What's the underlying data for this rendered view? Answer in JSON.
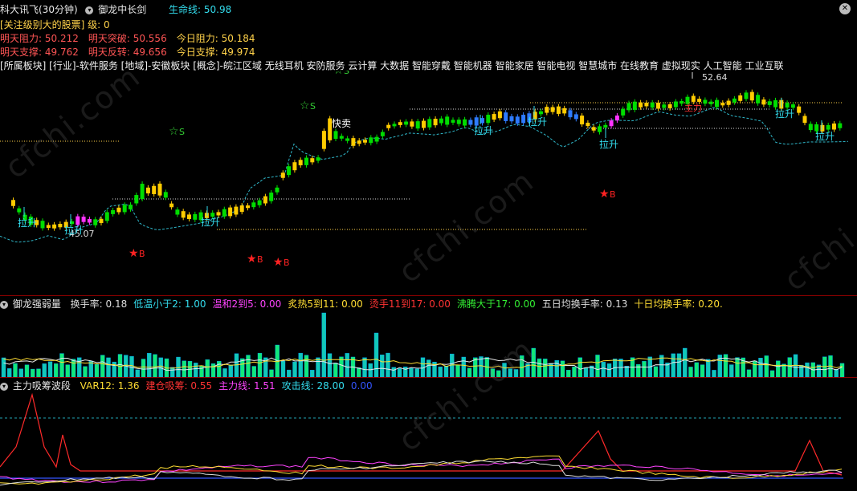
{
  "header": {
    "title": "科大讯飞(30分钟)",
    "indicator": "御龙中长剑",
    "lifeline_label": "生命线:",
    "lifeline_value": "50.98",
    "close_glyph": "✕"
  },
  "info": {
    "level_line": "[关注级别大的股票] 级: 0",
    "row1": [
      {
        "label": "明天阻力: 50.212",
        "color": "#ff5555"
      },
      {
        "label": "明天突破: 50.556",
        "color": "#ff5555"
      },
      {
        "label": "今日阻力: 50.184",
        "color": "#ffd24a"
      }
    ],
    "row2": [
      {
        "label": "明天支撑: 49.762",
        "color": "#ff5555"
      },
      {
        "label": "明天反转: 49.656",
        "color": "#ff5555"
      },
      {
        "label": "今日支撑: 49.974",
        "color": "#ffd24a"
      }
    ],
    "sectors": "[所属板块]  [行业]-软件服务  [地域]-安徽板块  [概念]-皖江区域 无线耳机 安防服务 云计算 大数据 智能穿戴 智能机器 智能家居 智能电视 智慧城市 在线教育 虚拟现实 人工智能 工业互联"
  },
  "main_chart": {
    "annotations": {
      "high_price": "52.64",
      "low_price": "45.07",
      "quick_sell": "快卖",
      "signal_buy": "B",
      "signal_sell": "S",
      "rise_label": "拉升",
      "main_label": "主力"
    },
    "colors": {
      "bull": "#ffcc00",
      "bear": "#00dd00",
      "magenta": "#ff33ff",
      "blue": "#2e7bff",
      "ma": "#2fb7c9",
      "sell_star": "#33cc33",
      "buy_star": "#ff2222"
    }
  },
  "volume_panel": {
    "title": "御龙强弱量",
    "items": [
      {
        "text": "换手率: 0.18",
        "color": "#dddddd"
      },
      {
        "text": "低温小于2: 1.00",
        "color": "#33ddee"
      },
      {
        "text": "温和2到5: 0.00",
        "color": "#ff44ff"
      },
      {
        "text": "炙热5到11: 0.00",
        "color": "#ffdd33"
      },
      {
        "text": "烫手11到17: 0.00",
        "color": "#ff3333"
      },
      {
        "text": "沸腾大于17: 0.00",
        "color": "#33ee33"
      },
      {
        "text": "五日均换手率: 0.13",
        "color": "#dddddd"
      },
      {
        "text": "十日均换手率: 0.20.",
        "color": "#ffdd33"
      }
    ]
  },
  "osc_panel": {
    "title": "主力吸筹波段",
    "items": [
      {
        "text": "VAR12: 1.36",
        "color": "#ffdd33"
      },
      {
        "text": "建仓吸筹: 0.55",
        "color": "#ff3333"
      },
      {
        "text": "主力线: 1.51",
        "color": "#ff44ff"
      },
      {
        "text": "攻击线: 28.00",
        "color": "#33ddee"
      },
      {
        "text": "0.00",
        "color": "#3355ff"
      }
    ]
  },
  "watermark": "cfchi.com"
}
